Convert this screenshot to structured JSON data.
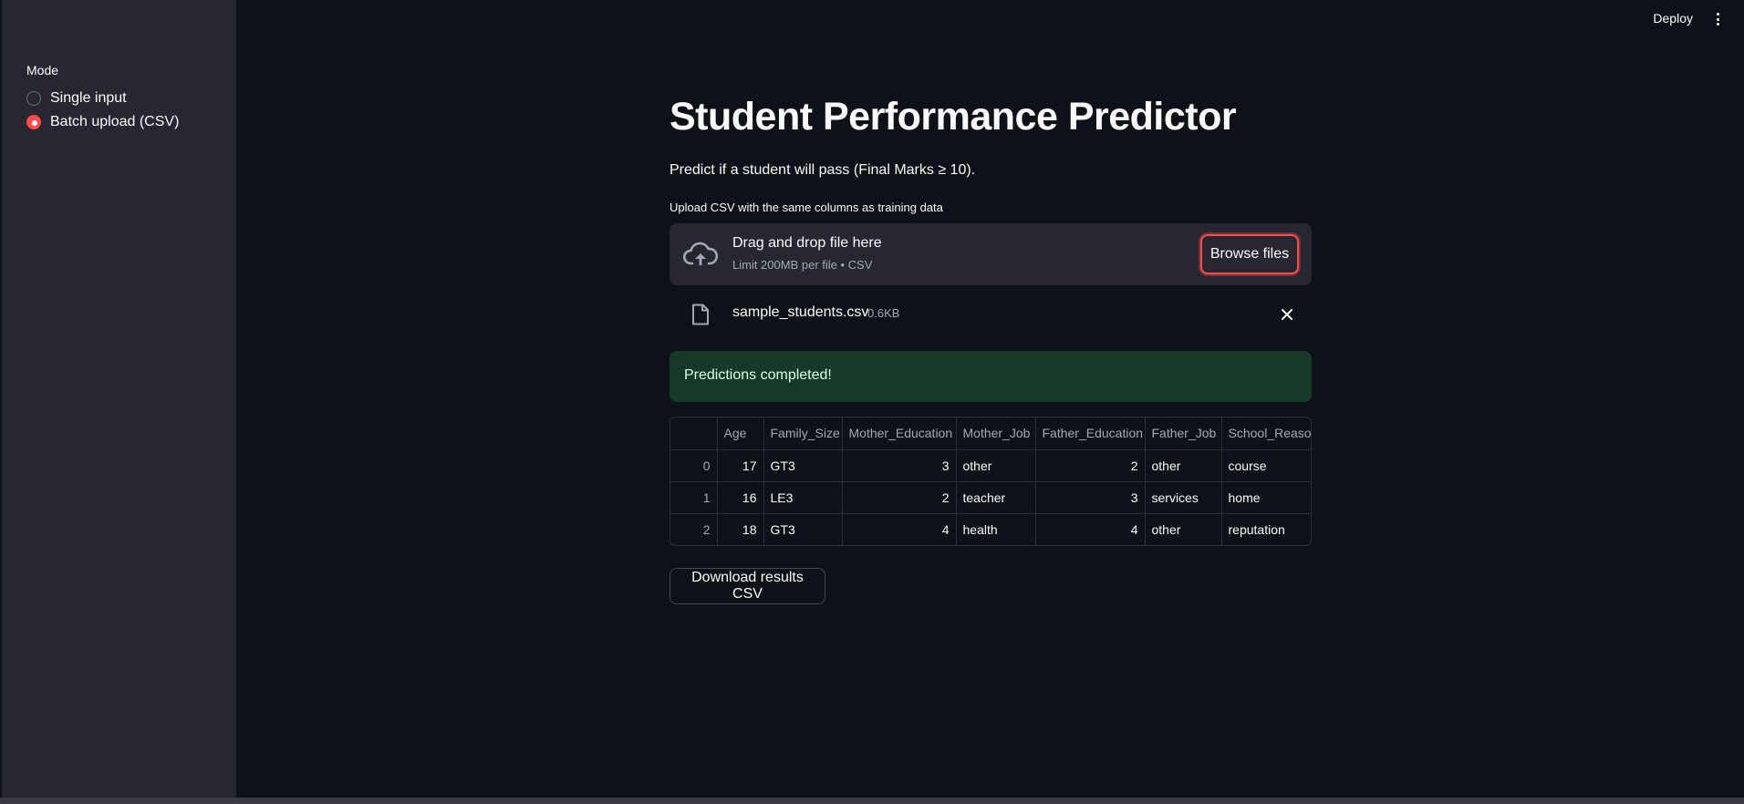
{
  "sidebar": {
    "mode_label": "Mode",
    "options": [
      {
        "label": "Single input",
        "selected": false
      },
      {
        "label": "Batch upload (CSV)",
        "selected": true
      }
    ]
  },
  "header": {
    "deploy_label": "Deploy",
    "menu_icon": "kebab-menu-icon"
  },
  "main": {
    "title": "Student Performance Predictor",
    "description": "Predict if a student will pass (Final Marks ≥ 10).",
    "uploader": {
      "label": "Upload CSV with the same columns as training data",
      "drop_title": "Drag and drop file here",
      "drop_sub": "Limit 200MB per file • CSV",
      "browse_label": "Browse files",
      "icon": "cloud-upload-icon"
    },
    "file": {
      "name": "sample_students.csv",
      "size": "0.6KB",
      "icon": "file-icon"
    },
    "success_message": "Predictions completed!",
    "table": {
      "columns": [
        "",
        "Age",
        "Family_Size",
        "Mother_Education",
        "Mother_Job",
        "Father_Education",
        "Father_Job",
        "School_Reason"
      ],
      "rows": [
        [
          "0",
          "17",
          "GT3",
          "3",
          "other",
          "2",
          "other",
          "course"
        ],
        [
          "1",
          "16",
          "LE3",
          "2",
          "teacher",
          "3",
          "services",
          "home"
        ],
        [
          "2",
          "18",
          "GT3",
          "4",
          "health",
          "4",
          "other",
          "reputation"
        ]
      ]
    },
    "download_label": "Download results CSV"
  },
  "colors": {
    "background": "#0e1117",
    "sidebar": "#262730",
    "accent": "#ff4b4b",
    "success_bg": "#173928"
  }
}
